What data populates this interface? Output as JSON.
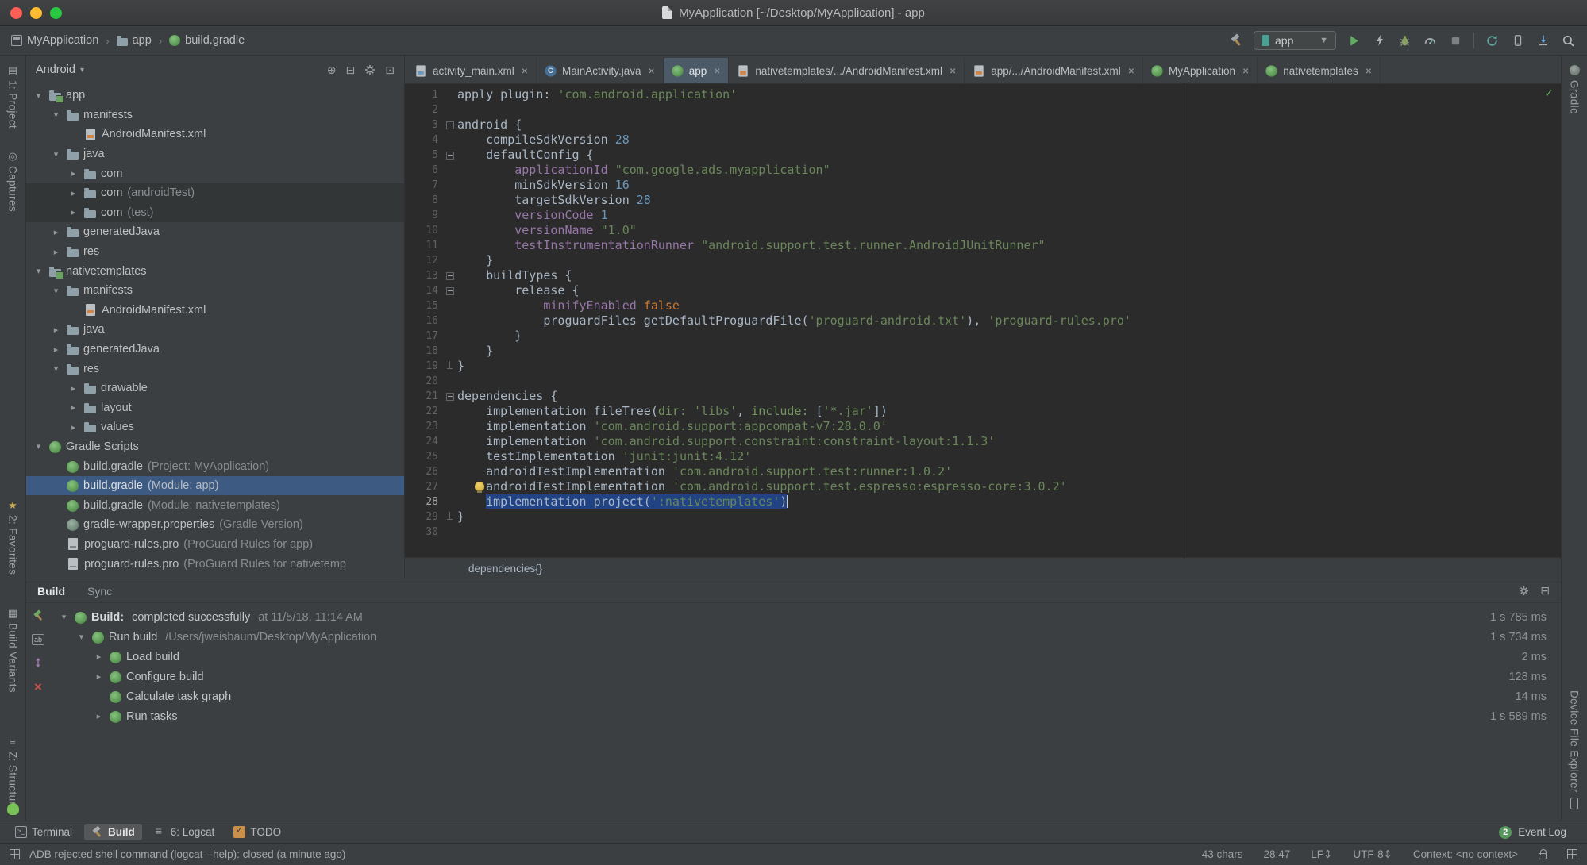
{
  "colors": {
    "editor_bg": "#2b2b2b",
    "panel_bg": "#3c3f41",
    "selection_blue": "#214283",
    "tree_selection_blue": "#3d5a82",
    "string_green": "#6a8759",
    "number_blue": "#6897bb",
    "keyword_orange": "#cc7832",
    "member_purple": "#9876aa",
    "run_green": "#5fad5f"
  },
  "window": {
    "title": "MyApplication [~/Desktop/MyApplication] - app"
  },
  "nav": {
    "breadcrumbs": [
      "MyApplication",
      "app",
      "build.gradle"
    ],
    "run_config": "app"
  },
  "left_strip": {
    "items": [
      {
        "label": "1: Project",
        "icon": "project"
      },
      {
        "label": "Captures",
        "icon": "captures"
      },
      {
        "label": "2: Favorites",
        "icon": "star"
      },
      {
        "label": "Build Variants",
        "icon": "variants"
      },
      {
        "label": "Z: Structure",
        "icon": "structure"
      }
    ]
  },
  "right_strip": {
    "top": "Gradle",
    "bottom": "Device File Explorer"
  },
  "project_panel": {
    "mode": "Android",
    "tree": [
      {
        "indent": 0,
        "chevron": "down",
        "icon": "module",
        "label": "app"
      },
      {
        "indent": 1,
        "chevron": "down",
        "icon": "folder",
        "label": "manifests"
      },
      {
        "indent": 2,
        "chevron": "none",
        "icon": "xmlfile",
        "label": "AndroidManifest.xml"
      },
      {
        "indent": 1,
        "chevron": "down",
        "icon": "folder",
        "label": "java"
      },
      {
        "indent": 2,
        "chevron": "right",
        "icon": "folder",
        "label": "com"
      },
      {
        "indent": 2,
        "chevron": "right",
        "icon": "folder",
        "label": "com",
        "extra": "(androidTest)",
        "shade": true
      },
      {
        "indent": 2,
        "chevron": "right",
        "icon": "folder",
        "label": "com",
        "extra": "(test)",
        "shade": true
      },
      {
        "indent": 1,
        "chevron": "right",
        "icon": "folder",
        "label": "generatedJava"
      },
      {
        "indent": 1,
        "chevron": "right",
        "icon": "folder",
        "label": "res"
      },
      {
        "indent": 0,
        "chevron": "down",
        "icon": "module",
        "label": "nativetemplates"
      },
      {
        "indent": 1,
        "chevron": "down",
        "icon": "folder",
        "label": "manifests"
      },
      {
        "indent": 2,
        "chevron": "none",
        "icon": "xmlfile",
        "label": "AndroidManifest.xml"
      },
      {
        "indent": 1,
        "chevron": "right",
        "icon": "folder",
        "label": "java"
      },
      {
        "indent": 1,
        "chevron": "right",
        "icon": "folder",
        "label": "generatedJava"
      },
      {
        "indent": 1,
        "chevron": "down",
        "icon": "folder",
        "label": "res"
      },
      {
        "indent": 2,
        "chevron": "right",
        "icon": "folder",
        "label": "drawable"
      },
      {
        "indent": 2,
        "chevron": "right",
        "icon": "folder",
        "label": "layout"
      },
      {
        "indent": 2,
        "chevron": "right",
        "icon": "folder",
        "label": "values"
      },
      {
        "indent": 0,
        "chevron": "down",
        "icon": "gradle",
        "label": "Gradle Scripts"
      },
      {
        "indent": 1,
        "chevron": "none",
        "icon": "gradle",
        "label": "build.gradle",
        "extra": "(Project: MyApplication)"
      },
      {
        "indent": 1,
        "chevron": "none",
        "icon": "gradle",
        "label": "build.gradle",
        "extra": "(Module: app)",
        "selected": true
      },
      {
        "indent": 1,
        "chevron": "none",
        "icon": "gradle",
        "label": "build.gradle",
        "extra": "(Module: nativetemplates)"
      },
      {
        "indent": 1,
        "chevron": "none",
        "icon": "gradle-wrapper",
        "label": "gradle-wrapper.properties",
        "extra": "(Gradle Version)"
      },
      {
        "indent": 1,
        "chevron": "none",
        "icon": "proguard",
        "label": "proguard-rules.pro",
        "extra": "(ProGuard Rules for app)"
      },
      {
        "indent": 1,
        "chevron": "none",
        "icon": "proguard",
        "label": "proguard-rules.pro",
        "extra": "(ProGuard Rules for nativetemp"
      }
    ]
  },
  "editor": {
    "tabs": [
      {
        "icon": "layout",
        "label": "activity_main.xml"
      },
      {
        "icon": "class",
        "label": "MainActivity.java"
      },
      {
        "icon": "gradle",
        "label": "app",
        "active": true
      },
      {
        "icon": "xmlfile",
        "label": "nativetemplates/.../AndroidManifest.xml"
      },
      {
        "icon": "xmlfile",
        "label": "app/.../AndroidManifest.xml"
      },
      {
        "icon": "gradle",
        "label": "MyApplication"
      },
      {
        "icon": "gradle",
        "label": "nativetemplates"
      }
    ],
    "breadcrumb": "dependencies{}",
    "selected_line": 28,
    "bulb_line": 27,
    "fold_open": [
      3,
      5,
      13,
      14,
      21
    ],
    "fold_close": [
      19,
      29
    ],
    "code": [
      [
        [
          "p",
          "apply plugin: "
        ],
        [
          "s",
          "'com.android.application'"
        ]
      ],
      [],
      [
        [
          "p",
          "android {"
        ]
      ],
      [
        [
          "p",
          "    compileSdkVersion "
        ],
        [
          "n",
          "28"
        ]
      ],
      [
        [
          "p",
          "    defaultConfig {"
        ]
      ],
      [
        [
          "p",
          "        "
        ],
        [
          "f",
          "applicationId"
        ],
        [
          "p",
          " "
        ],
        [
          "s",
          "\"com.google.ads.myapplication\""
        ]
      ],
      [
        [
          "p",
          "        minSdkVersion "
        ],
        [
          "n",
          "16"
        ]
      ],
      [
        [
          "p",
          "        targetSdkVersion "
        ],
        [
          "n",
          "28"
        ]
      ],
      [
        [
          "p",
          "        "
        ],
        [
          "f",
          "versionCode"
        ],
        [
          "p",
          " "
        ],
        [
          "n",
          "1"
        ]
      ],
      [
        [
          "p",
          "        "
        ],
        [
          "f",
          "versionName"
        ],
        [
          "p",
          " "
        ],
        [
          "s",
          "\"1.0\""
        ]
      ],
      [
        [
          "p",
          "        "
        ],
        [
          "f",
          "testInstrumentationRunner"
        ],
        [
          "p",
          " "
        ],
        [
          "s",
          "\"android.support.test.runner.AndroidJUnitRunner\""
        ]
      ],
      [
        [
          "p",
          "    }"
        ]
      ],
      [
        [
          "p",
          "    buildTypes {"
        ]
      ],
      [
        [
          "p",
          "        release {"
        ]
      ],
      [
        [
          "p",
          "            "
        ],
        [
          "f",
          "minifyEnabled"
        ],
        [
          "p",
          " "
        ],
        [
          "k",
          "false"
        ]
      ],
      [
        [
          "p",
          "            proguardFiles getDefaultProguardFile("
        ],
        [
          "s",
          "'proguard-android.txt'"
        ],
        [
          "p",
          "), "
        ],
        [
          "s",
          "'proguard-rules.pro'"
        ]
      ],
      [
        [
          "p",
          "        }"
        ]
      ],
      [
        [
          "p",
          "    }"
        ]
      ],
      [
        [
          "p",
          "}"
        ]
      ],
      [],
      [
        [
          "p",
          "dependencies {"
        ]
      ],
      [
        [
          "p",
          "    implementation fileTree("
        ],
        [
          "d",
          "dir:"
        ],
        [
          "p",
          " "
        ],
        [
          "s",
          "'libs'"
        ],
        [
          "p",
          ", "
        ],
        [
          "d",
          "include:"
        ],
        [
          "p",
          " ["
        ],
        [
          "s",
          "'*.jar'"
        ],
        [
          "p",
          "])"
        ]
      ],
      [
        [
          "p",
          "    implementation "
        ],
        [
          "s",
          "'com.android.support:appcompat-v7:28.0.0'"
        ]
      ],
      [
        [
          "p",
          "    implementation "
        ],
        [
          "s",
          "'com.android.support.constraint:constraint-layout:1.1.3'"
        ]
      ],
      [
        [
          "p",
          "    testImplementation "
        ],
        [
          "s",
          "'junit:junit:4.12'"
        ]
      ],
      [
        [
          "p",
          "    androidTestImplementation "
        ],
        [
          "s",
          "'com.android.support.test:runner:1.0.2'"
        ]
      ],
      [
        [
          "p",
          "    androidTestImplementation "
        ],
        [
          "s",
          "'com.android.support.test.espresso:espresso-core:3.0.2'"
        ]
      ],
      {
        "seg": [
          [
            "p",
            "    "
          ]
        ],
        "selseg": [
          [
            "p",
            "implementation project("
          ],
          [
            "s",
            "':nativetemplates'"
          ],
          [
            "p",
            ")"
          ]
        ],
        "caret": true
      },
      [
        [
          "p",
          "}"
        ]
      ],
      []
    ]
  },
  "build_panel": {
    "tabs": [
      {
        "label": "Build",
        "active": true
      },
      {
        "label": "Sync",
        "active": false
      }
    ],
    "rows": [
      {
        "indent": 0,
        "chevron": "down",
        "strong": "Build:",
        "label": "completed successfully",
        "detail": "at 11/5/18, 11:14 AM",
        "time": "1 s 785 ms"
      },
      {
        "indent": 1,
        "chevron": "down",
        "strong": "",
        "label": "Run build",
        "detail": "/Users/jweisbaum/Desktop/MyApplication",
        "time": "1 s 734 ms"
      },
      {
        "indent": 2,
        "chevron": "right",
        "strong": "",
        "label": "Load build",
        "detail": "",
        "time": "2 ms"
      },
      {
        "indent": 2,
        "chevron": "right",
        "strong": "",
        "label": "Configure build",
        "detail": "",
        "time": "128 ms"
      },
      {
        "indent": 2,
        "chevron": "none",
        "strong": "",
        "label": "Calculate task graph",
        "detail": "",
        "time": "14 ms"
      },
      {
        "indent": 2,
        "chevron": "right",
        "strong": "",
        "label": "Run tasks",
        "detail": "",
        "time": "1 s 589 ms"
      }
    ]
  },
  "bottom_bar": {
    "items": [
      {
        "label": "Terminal",
        "icon": "terminal",
        "active": false
      },
      {
        "label": "Build",
        "icon": "hammer",
        "active": true
      },
      {
        "label": "6: Logcat",
        "icon": "logcat",
        "active": false
      },
      {
        "label": "TODO",
        "icon": "todo",
        "active": false
      }
    ],
    "event_log": {
      "count": "2",
      "label": "Event Log"
    }
  },
  "status_bar": {
    "message": "ADB rejected shell command (logcat --help): closed (a minute ago)",
    "items": [
      "43 chars",
      "28:47",
      "LF⇕",
      "UTF-8⇕",
      "Context: <no context>"
    ]
  }
}
